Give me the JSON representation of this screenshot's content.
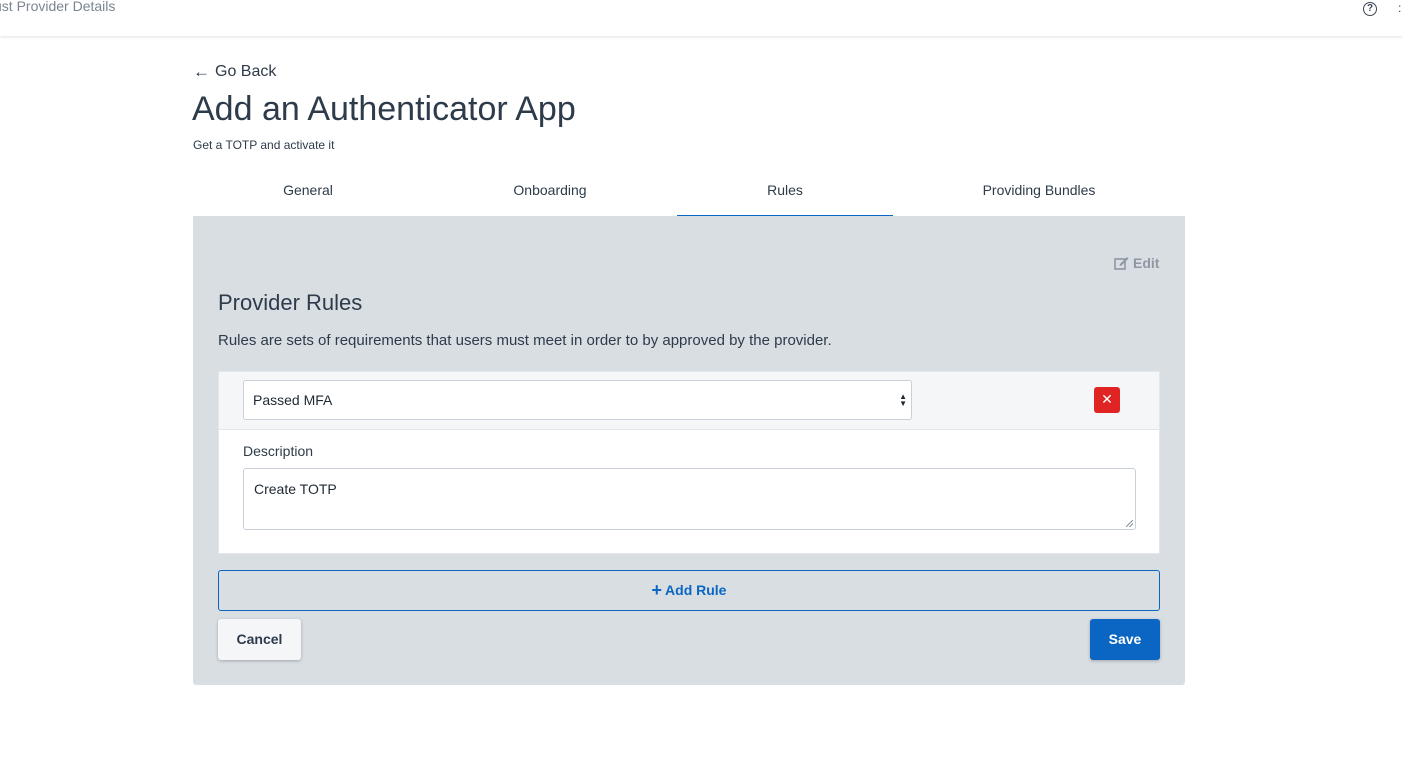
{
  "topbar": {
    "title": "ust Provider Details",
    "help_icon": "help-circle-icon",
    "help_glyph": "?",
    "more_icon": "more-icon",
    "more_glyph": ":"
  },
  "header": {
    "back_icon": "arrow-left-icon",
    "back_label": "Go Back",
    "title": "Add an Authenticator App",
    "subtitle": "Get a TOTP and activate it"
  },
  "tabs": [
    {
      "label": "General",
      "active": false
    },
    {
      "label": "Onboarding",
      "active": false
    },
    {
      "label": "Rules",
      "active": true
    },
    {
      "label": "Providing Bundles",
      "active": false
    }
  ],
  "panel": {
    "edit_icon": "edit-icon",
    "edit_label": "Edit",
    "title": "Provider Rules",
    "description": "Rules are sets of requirements that users must meet in order to by approved by the provider.",
    "rules": [
      {
        "selected": "Passed MFA",
        "description_label": "Description",
        "description_value": "Create TOTP",
        "delete_icon": "close-icon"
      }
    ],
    "add_rule_label": "Add Rule",
    "cancel_label": "Cancel",
    "save_label": "Save"
  },
  "colors": {
    "accent": "#0a66c2",
    "danger": "#e02424",
    "panel_bg": "#d9dee3",
    "text": "#2d3b4a"
  }
}
